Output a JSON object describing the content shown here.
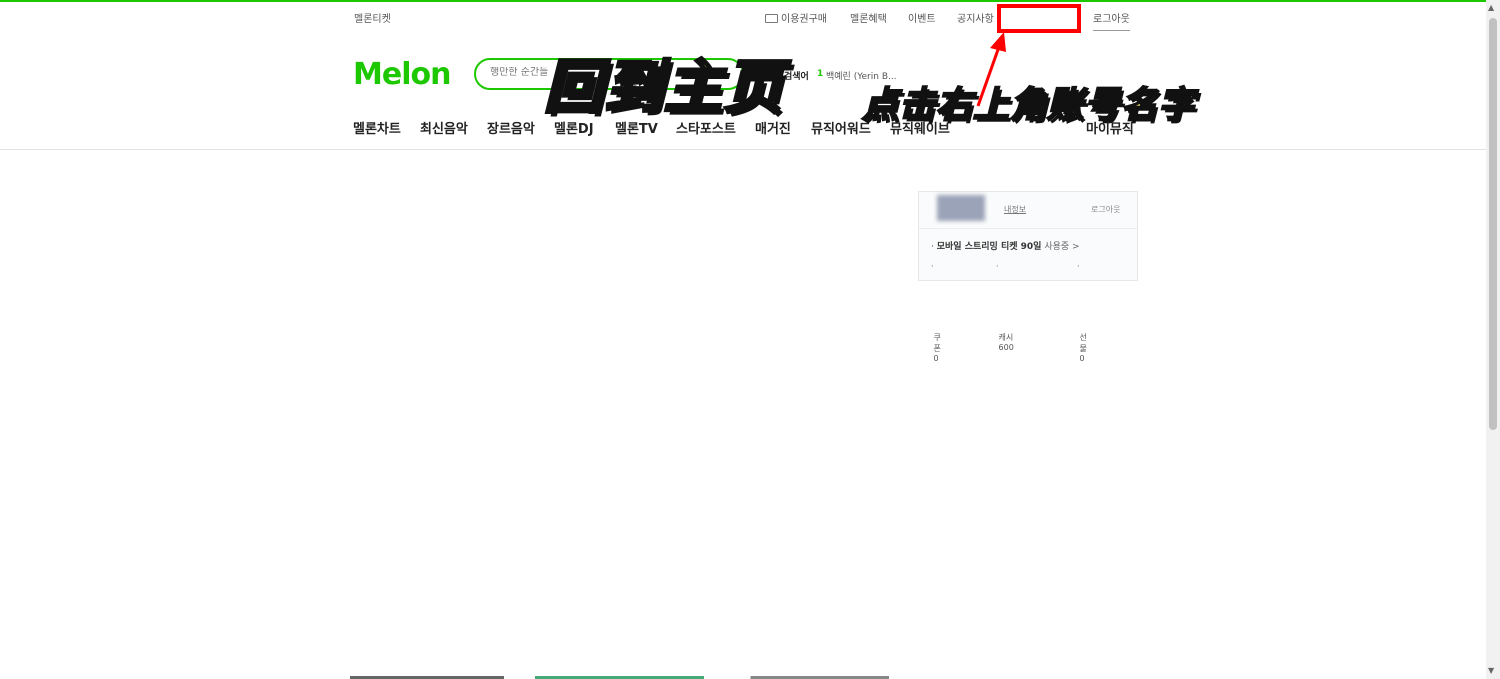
{
  "util": {
    "melon_ticket": "멜론티켓",
    "buy_pass": "이용권구매",
    "benefits": "멜론혜택",
    "event": "이벤트",
    "notice": "공지사항",
    "logout": "로그아웃"
  },
  "logo": "Melon",
  "search": {
    "placeholder": "행만한 순간들"
  },
  "realtime": {
    "label": "검색어",
    "rank": "1",
    "keyword": "백예린 (Yerin B..."
  },
  "overlay": {
    "title": "回到主页",
    "subtitle": "点击右上角账号名字"
  },
  "gnb": {
    "items": [
      "멜론차트",
      "최신음악",
      "장르음악",
      "멜론DJ",
      "멜론TV",
      "스타포스트",
      "매거진",
      "뮤직어워드",
      "뮤직웨이브"
    ],
    "mymusic": "마이뮤직"
  },
  "login_panel": {
    "myinfo": "내정보",
    "logout": "로그아웃",
    "ticket_name": "모바일 스트리밍 티켓 90일",
    "ticket_status": "사용중 >",
    "coupon": "쿠폰 0",
    "cash": "캐시 600",
    "gift": "선물 0"
  },
  "colors": {
    "brand": "#1ec800",
    "highlight": "#ff0000",
    "overlay_text": "#fff176"
  }
}
